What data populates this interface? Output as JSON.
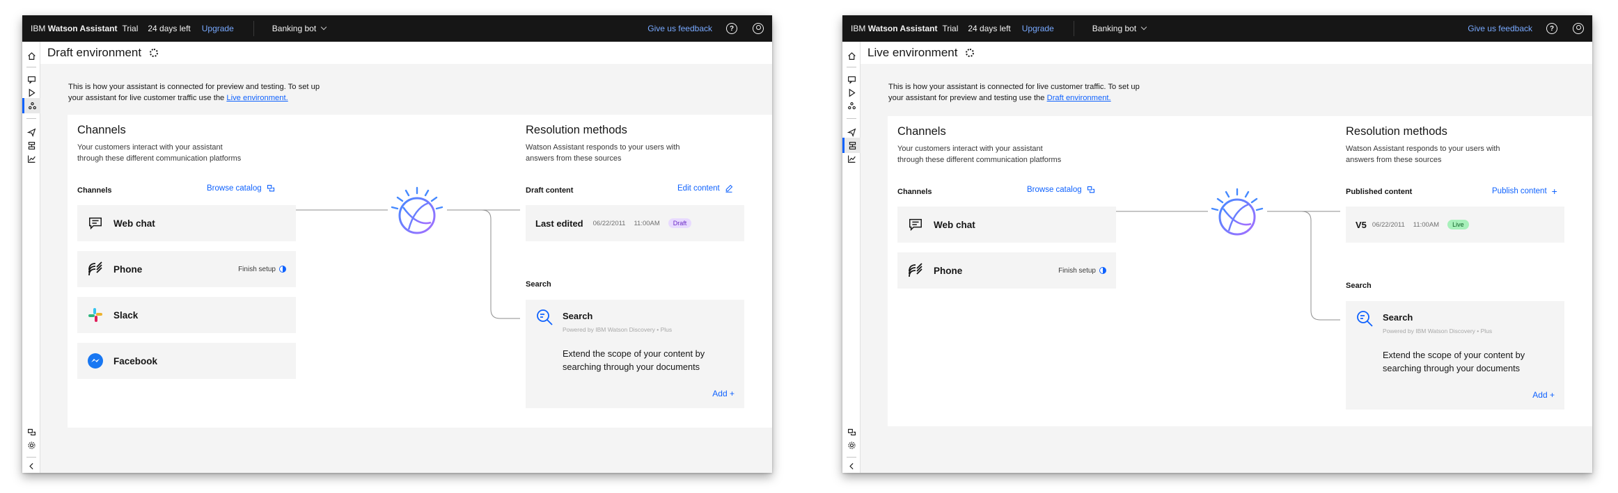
{
  "screens": [
    {
      "topbar": {
        "brand_prefix": "IBM",
        "brand_name": "Watson Assistant",
        "trial": "Trial",
        "days_left": "24 days left",
        "upgrade": "Upgrade",
        "bot_name": "Banking bot",
        "feedback": "Give us feedback",
        "help_icon": "help-icon",
        "user_icon": "user-avatar-icon"
      },
      "page_title": "Draft environment",
      "intro": {
        "text_1": "This is how your assistant is connected for preview and testing. To set up",
        "text_2": "your assistant for live customer traffic use the",
        "link": "Live environment."
      },
      "channels": {
        "title": "Channels",
        "desc_1": "Your customers interact with your assistant",
        "desc_2": "through these different communication platforms",
        "label": "Channels",
        "browse": "Browse catalog",
        "items": [
          {
            "label": "Web chat",
            "icon": "chat-icon"
          },
          {
            "label": "Phone",
            "icon": "phone-icon",
            "status": "Finish setup"
          },
          {
            "label": "Slack",
            "icon": "slack-logo"
          },
          {
            "label": "Facebook",
            "icon": "messenger-logo"
          }
        ]
      },
      "resolution": {
        "title": "Resolution methods",
        "desc_1": "Watson Assistant responds to your users with",
        "desc_2": "answers from these sources",
        "content_label": "Draft content",
        "content_action": "Edit content",
        "version_label": "Last edited",
        "date": "06/22/2011",
        "time": "11:00AM",
        "badge": "Draft",
        "badge_color": "#e8daff",
        "search_label": "Search",
        "search_title": "Search",
        "search_powered": "Powered by IBM Watson Discovery • Plus",
        "search_desc": "Extend the scope of your content by searching through your documents",
        "search_add": "Add  +"
      }
    },
    {
      "topbar": {
        "brand_prefix": "IBM",
        "brand_name": "Watson Assistant",
        "trial": "Trial",
        "days_left": "24 days left",
        "upgrade": "Upgrade",
        "bot_name": "Banking bot",
        "feedback": "Give us feedback",
        "help_icon": "help-icon",
        "user_icon": "user-avatar-icon"
      },
      "page_title": "Live environment",
      "intro": {
        "text_1": "This is how your assistant is connected for live customer traffic. To set up",
        "text_2": "your assistant for preview and testing use the",
        "link": "Draft environment."
      },
      "channels": {
        "title": "Channels",
        "desc_1": "Your customers interact with your assistant",
        "desc_2": "through these different communication platforms",
        "label": "Channels",
        "browse": "Browse catalog",
        "items": [
          {
            "label": "Web chat",
            "icon": "chat-icon"
          },
          {
            "label": "Phone",
            "icon": "phone-icon",
            "status": "Finish setup"
          }
        ]
      },
      "resolution": {
        "title": "Resolution methods",
        "desc_1": "Watson Assistant responds to your users with",
        "desc_2": "answers from these sources",
        "content_label": "Published content",
        "content_action": "Publish content",
        "version_label": "V5",
        "date": "06/22/2011",
        "time": "11:00AM",
        "badge": "Live",
        "badge_color": "#a7f0ba",
        "search_label": "Search",
        "search_title": "Search",
        "search_powered": "Powered by IBM Watson Discovery • Plus",
        "search_desc": "Extend the scope of your content by searching through your documents",
        "search_add": "Add  +"
      }
    }
  ],
  "accent_color": "#0f62fe"
}
